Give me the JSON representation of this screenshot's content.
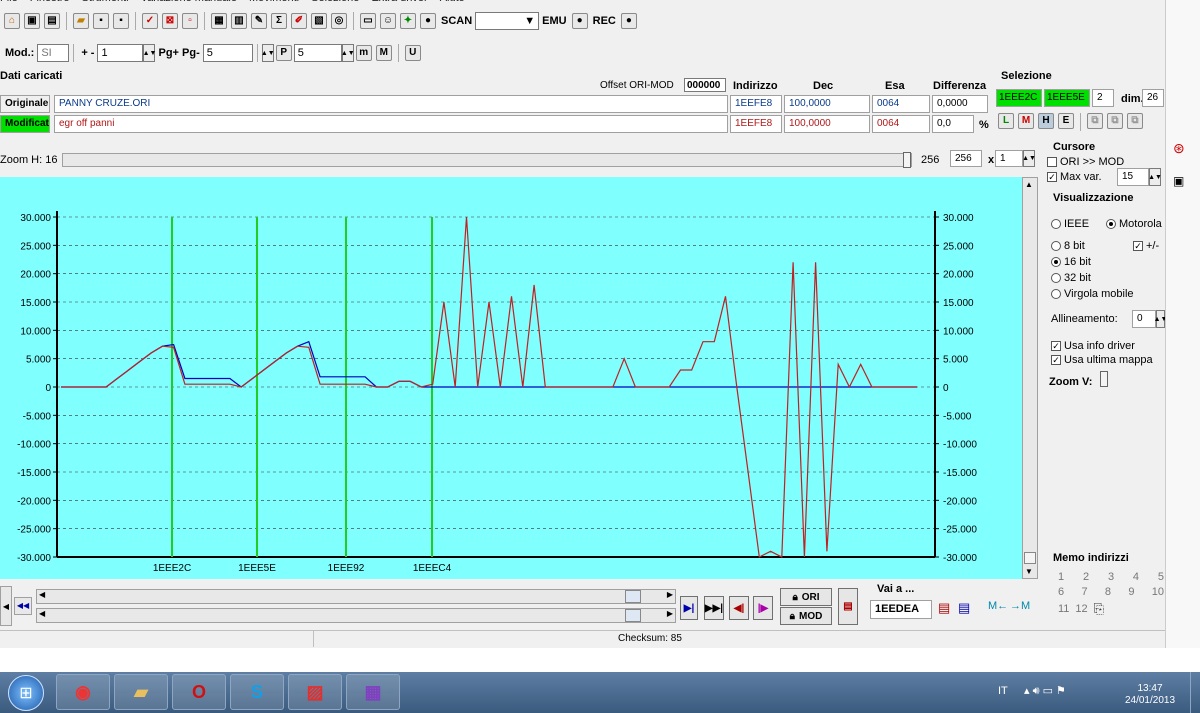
{
  "menu": [
    "File",
    "Finestre",
    "Strumenti",
    "Variazione manuale",
    "Movimenti",
    "Selezione",
    "Extra driver",
    "Aiuto"
  ],
  "toolbar": {
    "sigma_symbol": "Σ",
    "scan_label": "SCAN",
    "emu_label": "EMU",
    "rec_label": "REC"
  },
  "toolbar2": {
    "mod_label": "Mod.:",
    "mod_value": "SI",
    "plusminus_label": "+ -",
    "plusminus_value": "1",
    "pg_label": "Pg+ Pg-",
    "pg_value": "5",
    "p_value": "5"
  },
  "dati": {
    "title": "Dati caricati",
    "offset_label": "Offset ORI-MOD",
    "offset_value": "000000",
    "col_indirizzo": "Indirizzo",
    "col_dec": "Dec",
    "col_esa": "Esa",
    "col_diff": "Differenza",
    "orig_label": "Originale",
    "orig_file": "PANNY CRUZE.ORI",
    "orig_addr": "1EEFE8",
    "orig_dec": "100,0000",
    "orig_esa": "0064",
    "orig_diff": "0,0000",
    "mod_label": "Modificato",
    "mod_file": "egr off panni",
    "mod_addr": "1EEFE8",
    "mod_dec": "100,0000",
    "mod_esa": "0064",
    "mod_diff": "0,0",
    "percent": "%"
  },
  "selezione": {
    "title": "Selezione",
    "sel1": "1EEE2C",
    "sel2": "1EEE5E",
    "sel3": "2",
    "dim_label": "dim.",
    "dim_value": "26"
  },
  "zoom": {
    "label": "Zoom H: 16",
    "val1": "256",
    "val2": "256",
    "x_label": "x",
    "factor": "1"
  },
  "cursore": {
    "title": "Cursore",
    "ori_mod": "ORI >> MOD",
    "max_var_label": "Max var.",
    "max_var_value": "15"
  },
  "visualizzazione": {
    "title": "Visualizzazione",
    "ieee": "IEEE",
    "motorola": "Motorola",
    "b8": "8 bit",
    "plusminus": "+/-",
    "b16": "16 bit",
    "b32": "32 bit",
    "float": "Virgola mobile",
    "allineamento_label": "Allineamento:",
    "allineamento_value": "0",
    "info_driver": "Usa info driver",
    "ultima_mappa": "Usa ultima mappa",
    "zoom_v": "Zoom V:"
  },
  "memo": {
    "title": "Memo indirizzi",
    "row1": [
      "1",
      "2",
      "3",
      "4",
      "5"
    ],
    "row2": [
      "6",
      "7",
      "8",
      "9",
      "10"
    ],
    "row3": [
      "11",
      "12"
    ]
  },
  "bottom": {
    "ori_btn": "ORI",
    "mod_btn": "MOD",
    "vai_label": "Vai a ...",
    "vai_value": "1EEDEA",
    "checksum": "Checksum: 85"
  },
  "taskbar": {
    "lang": "IT",
    "time": "13:47",
    "date": "24/01/2013"
  },
  "colors": {
    "chart_bg": "#80ffff",
    "original_line": "#0000c0",
    "modified_line": "#c02020",
    "marker_line": "#22cc22",
    "selection_green": "#00e000"
  },
  "chart_data": {
    "type": "line",
    "ylim": [
      -30000,
      30000
    ],
    "yticks": [
      "30.000",
      "25.000",
      "20.000",
      "15.000",
      "10.000",
      "5.000",
      "0",
      "-5.000",
      "-10.000",
      "-15.000",
      "-20.000",
      "-25.000",
      "-30.000"
    ],
    "yticks_right": [
      "30.000",
      "25.000",
      "20.000",
      "15.000",
      "10.000",
      "5.000",
      "0",
      "-5.000",
      "-10.000",
      "-15.000",
      "-20.000",
      "-25.000",
      "-30.000"
    ],
    "xticks": [
      "1EEE2C",
      "1EEE5E",
      "1EEE92",
      "1EEEC4"
    ],
    "grid": true,
    "series": [
      {
        "name": "",
        "values": [
          0,
          0,
          0,
          0,
          0,
          1500,
          3000,
          4500,
          6000,
          7200,
          7500,
          1500,
          1500,
          1500,
          1500,
          1500,
          0,
          1500,
          3000,
          4500,
          6000,
          7200,
          8000,
          1800,
          1800,
          1800,
          1800,
          1800,
          0,
          0,
          1000,
          1000,
          0,
          0,
          0,
          0,
          0,
          0,
          0,
          0,
          0,
          0,
          0,
          0,
          0,
          0,
          0,
          0,
          0,
          0,
          0,
          0,
          0,
          0,
          0,
          0,
          0,
          0,
          0,
          0,
          0,
          0,
          0,
          0,
          0,
          0,
          0,
          0,
          0,
          0,
          0,
          0,
          0,
          0,
          0,
          0,
          0
        ]
      },
      {
        "name": "",
        "values": [
          0,
          0,
          0,
          0,
          0,
          1500,
          3000,
          4500,
          6000,
          7200,
          7000,
          500,
          500,
          500,
          500,
          500,
          0,
          1500,
          3000,
          4500,
          6000,
          7200,
          7000,
          500,
          500,
          500,
          500,
          500,
          0,
          0,
          1000,
          1000,
          0,
          500,
          15000,
          0,
          30000,
          0,
          15000,
          0,
          16000,
          0,
          18000,
          0,
          0,
          0,
          0,
          0,
          0,
          0,
          5000,
          0,
          0,
          0,
          0,
          3000,
          3000,
          8000,
          8000,
          16000,
          0,
          -15000,
          -30000,
          -29000,
          -30000,
          22000,
          -30000,
          22000,
          -29000,
          4000,
          0,
          4000,
          0,
          0,
          0,
          0,
          0
        ]
      }
    ]
  }
}
